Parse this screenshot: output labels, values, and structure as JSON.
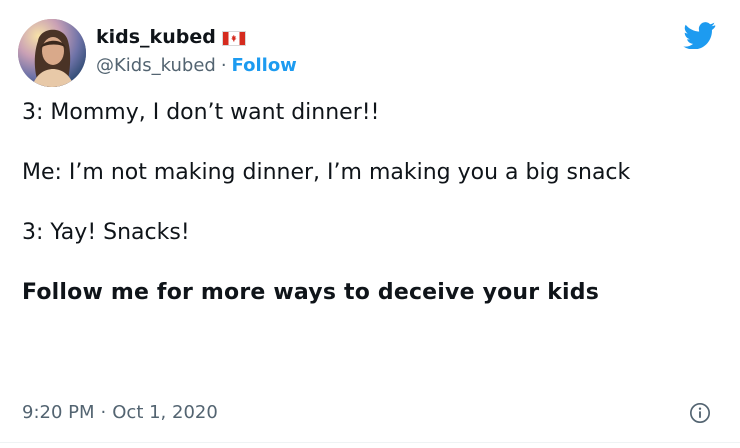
{
  "user": {
    "display_name": "kids_kubed",
    "handle": "@Kids_kubed",
    "separator": "·",
    "follow_label": "Follow",
    "flag_icon": "canada-flag-icon",
    "avatar_icon": "avatar-photo"
  },
  "platform": {
    "logo_icon": "twitter-bird-icon",
    "brand_color": "#1d9bf0"
  },
  "tweet": {
    "paragraphs": [
      "3: Mommy, I don’t want dinner!!",
      "Me: I’m not making dinner, I’m making you a big snack",
      "3: Yay! Snacks!"
    ],
    "bold_paragraph": "Follow me for more ways to deceive your kids"
  },
  "meta": {
    "time": "9:20 PM",
    "separator": "·",
    "date": "Oct 1, 2020",
    "info_icon": "info-icon"
  }
}
